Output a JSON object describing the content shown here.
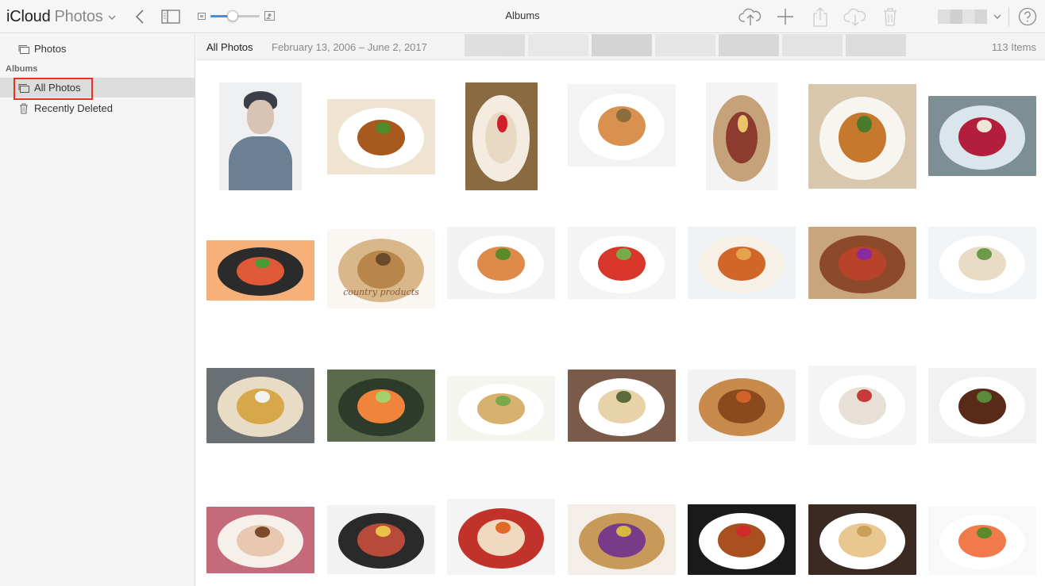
{
  "app": {
    "brand": "iCloud",
    "name": "Photos"
  },
  "toolbar": {
    "title": "Albums",
    "zoom_level": 0.45,
    "accent": "#3b90f0"
  },
  "sidebar": {
    "photos_label": "Photos",
    "albums_section": "Albums",
    "all_photos_label": "All Photos",
    "recently_deleted_label": "Recently Deleted",
    "highlight_color": "#e8321e"
  },
  "header": {
    "album": "All Photos",
    "dates": "February 13, 2006 – June 2, 2017",
    "count": "113 Items"
  },
  "photos": [
    {
      "desc": "portrait"
    },
    {
      "desc": "roast-chicken"
    },
    {
      "desc": "parfait"
    },
    {
      "desc": "bowl-soup"
    },
    {
      "desc": "charcuterie"
    },
    {
      "desc": "plated-dish"
    },
    {
      "desc": "berry-dish"
    },
    {
      "desc": "rice-platter"
    },
    {
      "desc": "bread-basket",
      "caption": "country products"
    },
    {
      "desc": "fish-fillet"
    },
    {
      "desc": "salad-plate"
    },
    {
      "desc": "crab"
    },
    {
      "desc": "roast-duck"
    },
    {
      "desc": "light-dish"
    },
    {
      "desc": "toast-box"
    },
    {
      "desc": "sushi"
    },
    {
      "desc": "sandwich"
    },
    {
      "desc": "stacked-pancake"
    },
    {
      "desc": "skewers"
    },
    {
      "desc": "dessert-plates"
    },
    {
      "desc": "steak"
    },
    {
      "desc": "tea-table"
    },
    {
      "desc": "paella-pan"
    },
    {
      "desc": "noodle-bowl"
    },
    {
      "desc": "steamer-basket"
    },
    {
      "desc": "glazed-duck"
    },
    {
      "desc": "pastry-plate"
    },
    {
      "desc": "salmon"
    }
  ]
}
